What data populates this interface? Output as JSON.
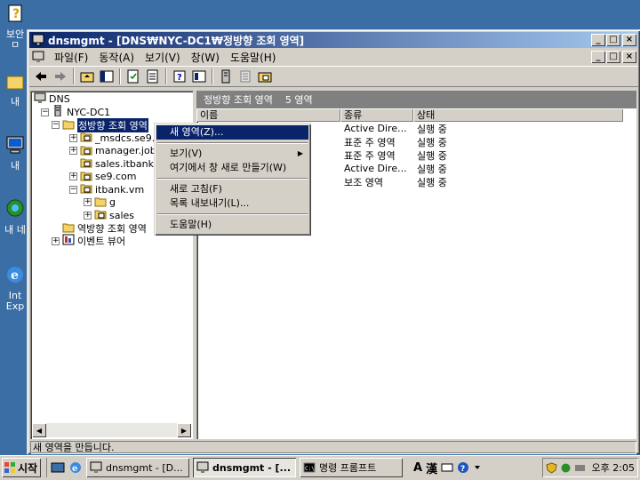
{
  "desktop": {
    "icons": [
      {
        "label": "보안",
        "label2": "ㅁ",
        "name": "security-icon"
      },
      {
        "label": "내",
        "name": "my-documents-icon"
      },
      {
        "label": "내 ",
        "name": "my-computer-icon"
      },
      {
        "label": "내 네",
        "name": "network-icon"
      },
      {
        "label": "Int",
        "label2": "Exp",
        "name": "internet-explorer-icon"
      }
    ]
  },
  "window": {
    "title": "dnsmgmt - [DNS₩NYC-DC1₩정방향 조회 영역]",
    "minimize": "_",
    "maximize": "□",
    "close": "×"
  },
  "menubar": {
    "items": [
      "파일(F)",
      "동작(A)",
      "보기(V)",
      "창(W)",
      "도움말(H)"
    ]
  },
  "tree": {
    "items": [
      {
        "label": "DNS",
        "level": 0,
        "expander": "",
        "icon": "dns-icon"
      },
      {
        "label": "NYC-DC1",
        "level": 1,
        "expander": "−",
        "icon": "server-icon"
      },
      {
        "label": "정방향 조회 영역",
        "level": 2,
        "expander": "−",
        "icon": "folder-icon",
        "selected": true
      },
      {
        "label": "_msdcs.se9.",
        "level": 3,
        "expander": "+",
        "icon": "zone-icon"
      },
      {
        "label": "manager.jobl",
        "level": 3,
        "expander": "+",
        "icon": "zone-icon"
      },
      {
        "label": "sales.itbank.",
        "level": 3,
        "expander": "",
        "icon": "zone-icon"
      },
      {
        "label": "se9.com",
        "level": 3,
        "expander": "+",
        "icon": "zone-icon"
      },
      {
        "label": "itbank.vm",
        "level": 3,
        "expander": "−",
        "icon": "zone-icon"
      },
      {
        "label": "g",
        "level": 4,
        "expander": "+",
        "icon": "folder-icon"
      },
      {
        "label": "sales",
        "level": 4,
        "expander": "+",
        "icon": "zone-icon"
      },
      {
        "label": "역방향 조회 영역",
        "level": 2,
        "expander": "",
        "icon": "folder-icon"
      },
      {
        "label": "이벤트 뷰어",
        "level": 2,
        "expander": "+",
        "icon": "event-viewer-icon"
      }
    ]
  },
  "panel": {
    "title": "정방향 조회 영역",
    "count": "5 영역",
    "columns": [
      "이름",
      "종류",
      "상태"
    ],
    "rows": [
      {
        "name": "",
        "type": "Active Dire...",
        "status": "실행 중"
      },
      {
        "name": "",
        "type": "표준 주 영역",
        "status": "실행 중"
      },
      {
        "name": "",
        "type": "표준 주 영역",
        "status": "실행 중"
      },
      {
        "name": "",
        "type": "Active Dire...",
        "status": "실행 중"
      },
      {
        "name": "",
        "type": "보조 영역",
        "status": "실행 중"
      }
    ]
  },
  "context_menu": {
    "items": [
      {
        "label": "새 영역(Z)...",
        "highlighted": true
      },
      {
        "sep": true
      },
      {
        "label": "보기(V)",
        "submenu": true
      },
      {
        "label": "여기에서 창 새로 만들기(W)"
      },
      {
        "sep": true
      },
      {
        "label": "새로 고침(F)"
      },
      {
        "label": "목록 내보내기(L)..."
      },
      {
        "sep": true
      },
      {
        "label": "도움말(H)"
      }
    ]
  },
  "statusbar": {
    "text": "새 영역을 만듭니다."
  },
  "taskbar": {
    "start": "시작",
    "tasks": [
      {
        "label": "dnsmgmt - [D...",
        "active": false,
        "icon": "dns-icon"
      },
      {
        "label": "dnsmgmt - [...",
        "active": true,
        "icon": "dns-icon"
      },
      {
        "label": "명령 프롬프트",
        "active": false,
        "icon": "cmd-icon"
      }
    ],
    "ime": {
      "mode": "A",
      "hanja": "漢"
    },
    "clock": "오후 2:05"
  },
  "colors": {
    "desktop": "#3a6ea5",
    "titlebar": "#0a246a",
    "face": "#d4d0c8",
    "selection": "#0a246a"
  }
}
